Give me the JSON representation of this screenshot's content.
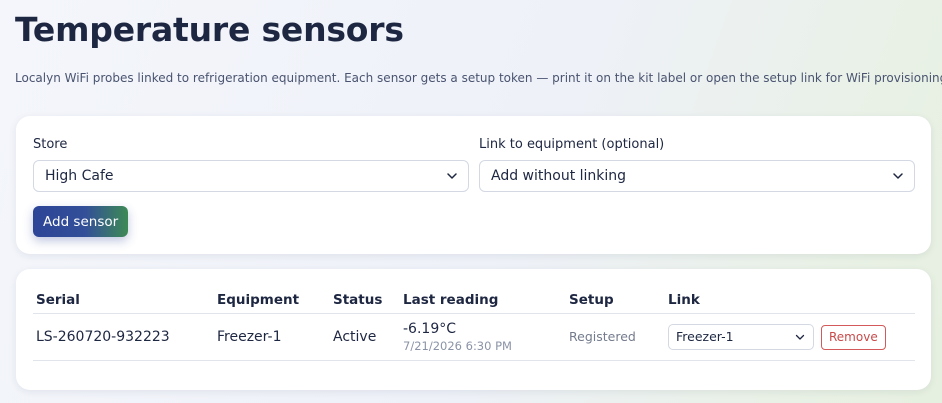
{
  "page": {
    "title": "Temperature sensors",
    "subtitle": "Localyn WiFi probes linked to refrigeration equipment. Each sensor gets a setup token — print it on the kit label or open the setup link for WiFi provisioning."
  },
  "form": {
    "store_label": "Store",
    "store_value": "High Cafe",
    "equipment_label": "Link to equipment (optional)",
    "equipment_value": "Add without linking",
    "add_button": "Add sensor"
  },
  "table": {
    "headers": {
      "serial": "Serial",
      "equipment": "Equipment",
      "status": "Status",
      "last_reading": "Last reading",
      "setup": "Setup",
      "link": "Link"
    },
    "rows": [
      {
        "serial": "LS-260720-932223",
        "equipment": "Freezer-1",
        "status": "Active",
        "reading_value": "-6.19°C",
        "reading_time": "7/21/2026 6:30 PM",
        "setup": "Registered",
        "link_value": "Freezer-1",
        "remove_label": "Remove"
      }
    ]
  },
  "icons": {
    "select_chevron": "chevron-down-icon"
  },
  "colors": {
    "accent_start": "#2d4597",
    "accent_end": "#3d8a55",
    "remove": "#c84a4a",
    "text": "#1e2742"
  }
}
